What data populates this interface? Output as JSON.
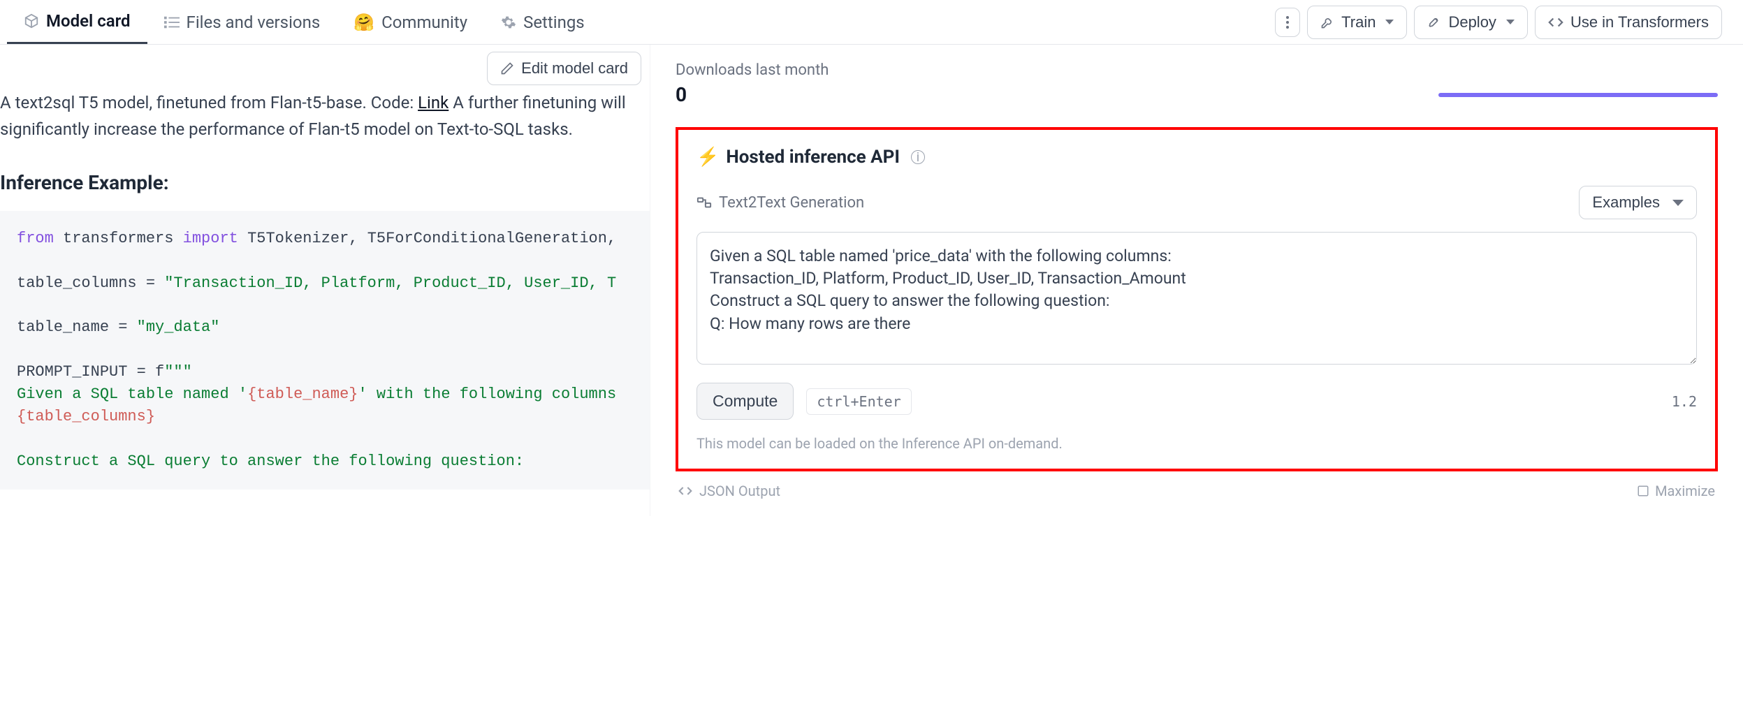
{
  "tabs": {
    "model_card": "Model card",
    "files": "Files and versions",
    "community": "Community",
    "settings": "Settings"
  },
  "toolbar": {
    "train": "Train",
    "deploy": "Deploy",
    "use_in_transformers": "Use in Transformers",
    "edit_model_card": "Edit model card"
  },
  "desc": {
    "prefix": "A text2sql T5 model, finetuned from Flan-t5-base. Code: ",
    "link_text": "Link",
    "suffix": " A further finetuning will significantly increase the performance of Flan-t5 model on Text-to-SQL tasks."
  },
  "heading_inference_example": "Inference Example:",
  "code": {
    "l1_from": "from",
    "l1_mid": " transformers ",
    "l1_import": "import",
    "l1_rest": " T5Tokenizer, T5ForConditionalGeneration,",
    "l2_lhs": "table_columns = ",
    "l2_str": "\"Transaction_ID, Platform, Product_ID, User_ID, T",
    "l3_lhs": "table_name = ",
    "l3_str": "\"my_data\"",
    "l4_lhs": "PROMPT_INPUT = f",
    "l4_q": "\"\"\"",
    "l5a": "Given a SQL table named '",
    "l5b": "{table_name}",
    "l5c": "' with the following columns",
    "l6": "{table_columns}",
    "l7": "Construct a SQL query to answer the following question:"
  },
  "downloads": {
    "label": "Downloads last month",
    "count": "0"
  },
  "inference": {
    "title": "Hosted inference API",
    "task": "Text2Text Generation",
    "examples_label": "Examples",
    "prompt": "Given a SQL table named 'price_data' with the following columns:\nTransaction_ID, Platform, Product_ID, User_ID, Transaction_Amount\nConstruct a SQL query to answer the following question:\nQ: How many rows are there",
    "compute": "Compute",
    "shortcut": "ctrl+Enter",
    "timing": "1.2",
    "load_msg": "This model can be loaded on the Inference API on-demand."
  },
  "footer": {
    "json_output": "JSON Output",
    "maximize": "Maximize"
  }
}
